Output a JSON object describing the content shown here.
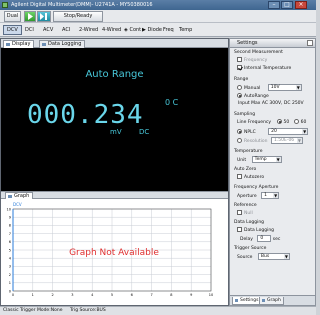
{
  "window": {
    "title": "Agilent Digital Multimeter(DMM)- U2741A - MY50380016"
  },
  "toolbar": {
    "dual_label": "Dual",
    "stop_ready_label": "Stop/Ready"
  },
  "modes": [
    "DCV",
    "DCI",
    "ACV",
    "ACI",
    "2-Wired",
    "4-Wired",
    "Cont",
    "Diode",
    "Freq",
    "Temp"
  ],
  "tabs": {
    "display": "Display",
    "data_logging": "Data Logging",
    "graph": "Graph"
  },
  "display": {
    "range_text": "Auto Range",
    "reading": "000.234",
    "unit": "mV",
    "coupling": "DC",
    "secondary": "0 C"
  },
  "graph": {
    "y_axis_label": "DCV",
    "message": "Graph Not Available",
    "y_ticks": [
      "10",
      "9",
      "8",
      "7",
      "6",
      "5",
      "4",
      "3",
      "2",
      "1",
      "0"
    ],
    "x_ticks": [
      "0",
      "1",
      "2",
      "3",
      "4",
      "5",
      "6",
      "7",
      "8",
      "9",
      "10"
    ]
  },
  "settings": {
    "header": "Settings",
    "second_measurement": {
      "title": "Second Measurement",
      "frequency": "Frequency",
      "internal_temperature": "Internal Temperature"
    },
    "range": {
      "title": "Range",
      "manual": "Manual",
      "manual_value": "10V",
      "autorange": "AutoRange",
      "note": "Input Max AC 300V, DC 250V"
    },
    "sampling": {
      "title": "Sampling",
      "line_frequency": "Line Frequency",
      "freq_50": "50",
      "freq_60": "60",
      "nplc": "NPLC",
      "nplc_value": "20",
      "resolution": "Resolution",
      "resolution_value": "1.50E-06"
    },
    "temperature": {
      "title": "Temperature",
      "unit_label": "Unit",
      "unit_value": "Temp"
    },
    "auto_zero": {
      "title": "Auto Zero",
      "autozero": "Autozero"
    },
    "frequency_aperture": {
      "title": "Frequency Aperture",
      "aperture": "Aperture",
      "aperture_value": "1"
    },
    "reference": {
      "title": "Reference",
      "null": "Null"
    },
    "data_logging": {
      "title": "Data Logging",
      "checkbox": "Data Logging",
      "delay_label": "Delay",
      "delay_value": "0",
      "delay_unit": "sec"
    },
    "trigger_source": {
      "title": "Trigger Source",
      "source_label": "Source",
      "source_value": "Bus"
    },
    "footer_tabs": [
      "Settings",
      "Graph"
    ]
  },
  "status": {
    "trigger_mode": "Classic Trigger Mode:None",
    "trig_source": "Trig Source:BUS"
  },
  "colors": {
    "display_bg": "#000000",
    "display_text": "#48c7d9",
    "graph_message": "#e03030",
    "graph_trace": "#2a7bd8"
  }
}
